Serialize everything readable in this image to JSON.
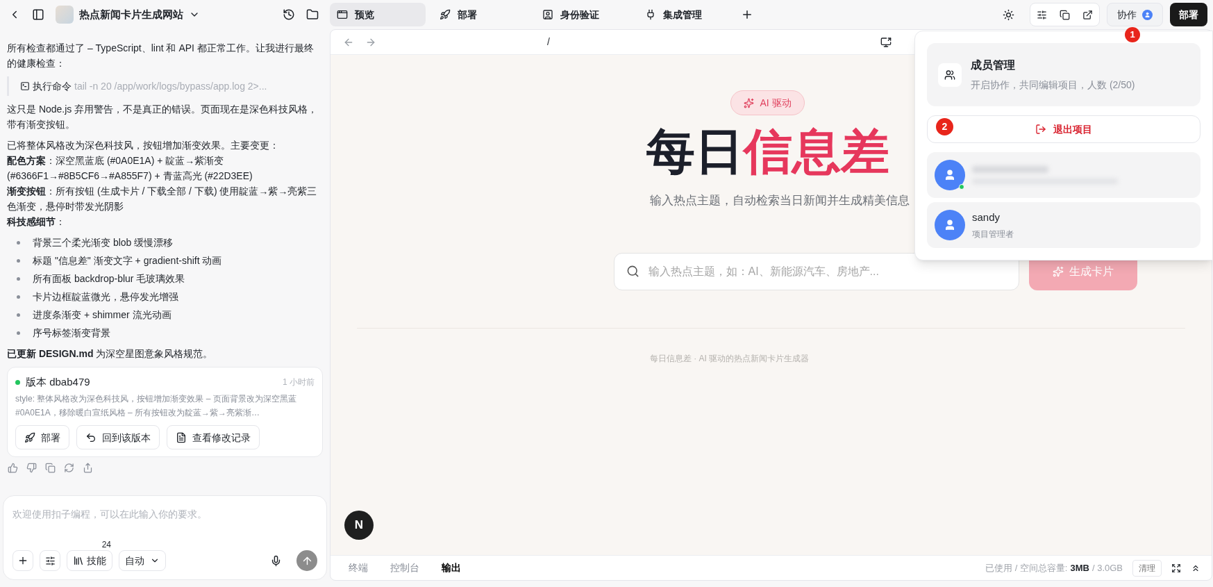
{
  "header": {
    "project_title": "热点新闻卡片生成网站"
  },
  "chat": {
    "blocks": [
      {
        "kind": "text",
        "text": "所有检查都通过了 – TypeScript、lint 和 API 都正常工作。让我进行最终的健康检查："
      },
      {
        "kind": "command",
        "label": "执行命令",
        "command": "tail -n 20 /app/work/logs/bypass/app.log 2>..."
      },
      {
        "kind": "text",
        "text": "这只是 Node.js 弃用警告，不是真正的错误。页面现在是深色科技风格，带有渐变按钮。"
      },
      {
        "kind": "lines",
        "lines": [
          "已将整体风格改为深色科技风，按钮增加渐变效果。主要变更：",
          "**配色方案**：深空黑蓝底 (#0A0E1A) + 靛蓝→紫渐变 (#6366F1→#8B5CF6→#A855F7) + 青蓝高光 (#22D3EE)",
          "**渐变按钮**：所有按钮 (生成卡片 / 下载全部 / 下载) 使用靛蓝→紫→亮紫三色渐变，悬停时带发光阴影",
          "**科技感细节**："
        ]
      },
      {
        "kind": "bullets",
        "items": [
          "背景三个柔光渐变 blob 缓慢漂移",
          "标题 \"信息差\" 渐变文字 + gradient-shift 动画",
          "所有面板 backdrop-blur 毛玻璃效果",
          "卡片边框靛蓝微光，悬停发光增强",
          "进度条渐变 + shimmer 流光动画",
          "序号标签渐变背景"
        ]
      },
      {
        "kind": "text",
        "text": "**已更新 DESIGN.md** 为深空星图意象风格规范。"
      }
    ],
    "version": {
      "title": "版本 dbab479",
      "time": "1 小时前",
      "description": "style: 整体风格改为深色科技风，按钮增加渐变效果 – 页面背景改为深空黑蓝 #0A0E1A，移除暖白宣纸风格 – 所有按钮改为靛蓝→紫→亮紫渐…",
      "buttons": [
        {
          "kind": "deploy",
          "label": "部署"
        },
        {
          "kind": "revert",
          "label": "回到该版本"
        },
        {
          "kind": "log",
          "label": "查看修改记录"
        }
      ]
    },
    "input": {
      "placeholder": "欢迎使用扣子编程，可以在此输入你的要求。",
      "skills_label": "技能",
      "skills_count": "24",
      "mode": "自动"
    }
  },
  "tabs": [
    {
      "kind": "preview",
      "label": "预览",
      "selected": true
    },
    {
      "kind": "deploy",
      "label": "部署",
      "selected": false
    },
    {
      "kind": "auth",
      "label": "身份验证",
      "selected": false
    },
    {
      "kind": "integration",
      "label": "集成管理",
      "selected": false
    }
  ],
  "toolbar": {
    "collab_label": "协作",
    "collab_badge": "1",
    "deploy_label": "部署"
  },
  "preview": {
    "url": "/",
    "badge": "AI 驱动",
    "title_dark": "每日",
    "title_accent": "信息差",
    "subtitle": "输入热点主题，自动检索当日新闻并生成精美信息",
    "search_placeholder": "输入热点主题，如：AI、新能源汽车、房地产...",
    "generate_label": "生成卡片",
    "generate_disabled": true,
    "footer": "每日信息差 · AI 驱动的热点新闻卡片生成器",
    "dev_badge": "N"
  },
  "bottom_bar": {
    "tabs": [
      {
        "label": "终端",
        "selected": false
      },
      {
        "label": "控制台",
        "selected": false
      },
      {
        "label": "输出",
        "selected": true
      }
    ],
    "storage_label": "已使用 / 空间总容量:",
    "storage_used": "3MB",
    "storage_total": "/ 3.0GB",
    "clear_label": "清理"
  },
  "collab_menu": {
    "title": "成员管理",
    "description": "开启协作，共同编辑项目，人数 (2/50)",
    "exit_label": "退出项目",
    "exit_badge": "2",
    "members": [
      {
        "kind": "hidden",
        "online": true
      },
      {
        "kind": "named",
        "name": "sandy",
        "role": "项目管理者",
        "online": false
      }
    ]
  }
}
